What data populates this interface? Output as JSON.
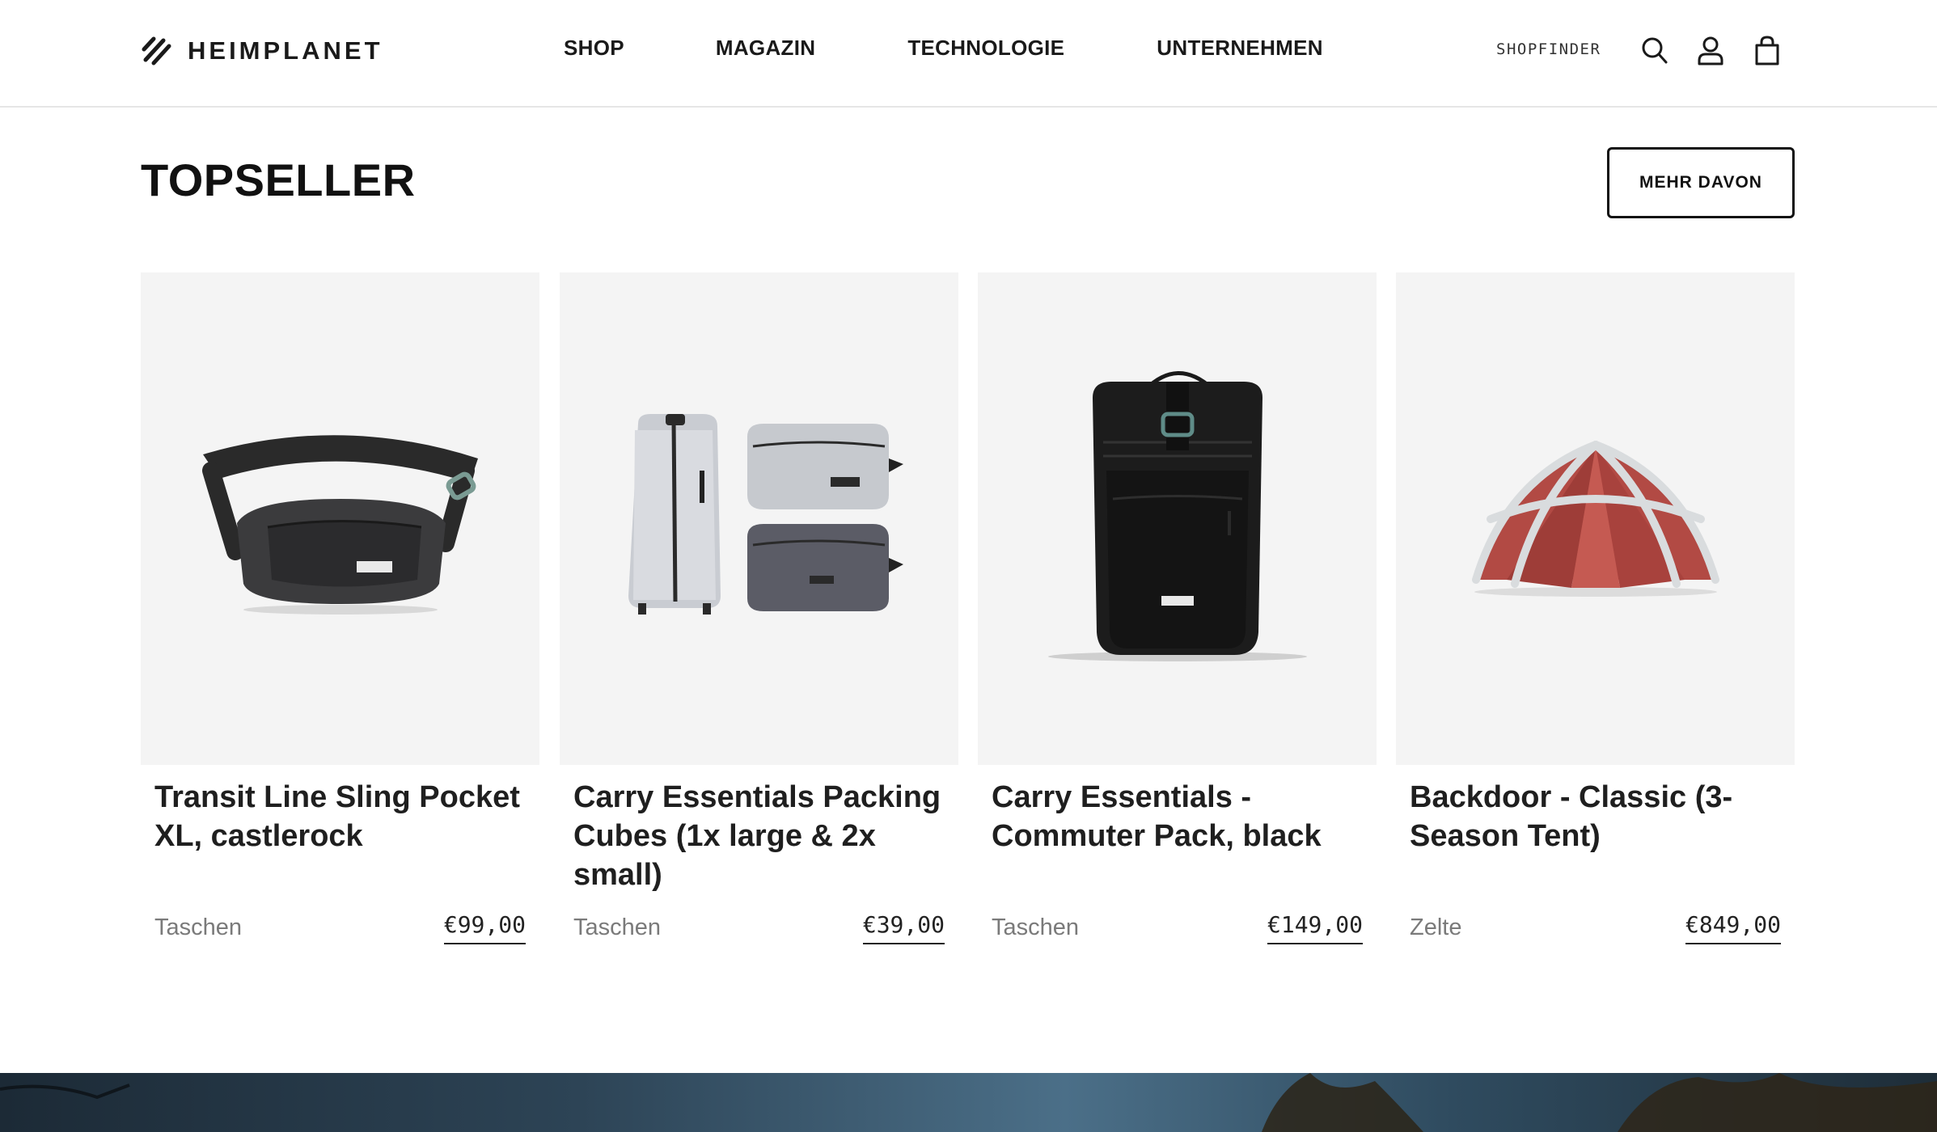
{
  "header": {
    "logo_text": "HEIMPLANET",
    "nav": [
      "SHOP",
      "MAGAZIN",
      "TECHNOLOGIE",
      "UNTERNEHMEN"
    ],
    "shopfinder": "SHOPFINDER",
    "icons": [
      "search-icon",
      "account-icon",
      "cart-icon"
    ]
  },
  "section": {
    "title": "TOPSELLER",
    "more_button": "MEHR DAVON"
  },
  "products": [
    {
      "name": "Transit Line Sling Pocket XL, castlerock",
      "category": "Taschen",
      "price": "€99,00",
      "image": "sling-bag"
    },
    {
      "name": "Carry Essentials Packing Cubes (1x large & 2x small)",
      "category": "Taschen",
      "price": "€39,00",
      "image": "packing-cubes"
    },
    {
      "name": "Carry Essentials - Commuter Pack, black",
      "category": "Taschen",
      "price": "€149,00",
      "image": "backpack"
    },
    {
      "name": "Backdoor - Classic (3-Season Tent)",
      "category": "Zelte",
      "price": "€849,00",
      "image": "tent"
    }
  ],
  "colors": {
    "text": "#1a1a1a",
    "muted": "#7a7a7a",
    "card_bg": "#f4f4f4",
    "tent_red": "#b24a44"
  }
}
